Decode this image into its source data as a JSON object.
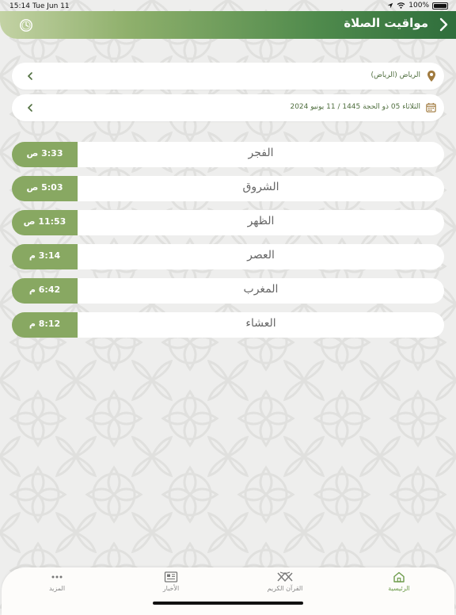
{
  "status_bar": {
    "time": "15:14",
    "date": "Tue Jun 11",
    "battery": "100%"
  },
  "header": {
    "title": "مواقيت الصلاة"
  },
  "location": {
    "text": "الرياض (الرياض)"
  },
  "date_selector": {
    "text": "الثلاثاء 05 ذو الحجة 1445 / 11 يونيو 2024"
  },
  "prayers": [
    {
      "name": "الفجر",
      "time": "3:33 ص"
    },
    {
      "name": "الشروق",
      "time": "5:03 ص"
    },
    {
      "name": "الظهر",
      "time": "11:53 ص"
    },
    {
      "name": "العصر",
      "time": "3:14 م"
    },
    {
      "name": "المغرب",
      "time": "6:42 م"
    },
    {
      "name": "العشاء",
      "time": "8:12 م"
    }
  ],
  "tabs": [
    {
      "label": "الرئيسية",
      "icon": "home-icon",
      "active": true
    },
    {
      "label": "القرآن الكريم",
      "icon": "quran-icon",
      "active": false
    },
    {
      "label": "الأخبار",
      "icon": "news-icon",
      "active": false
    },
    {
      "label": "المزيد",
      "icon": "more-icon",
      "active": false
    }
  ],
  "colors": {
    "accent": "#88a862",
    "header_dark": "#2f6e3c",
    "header_light": "#c3d2a4"
  }
}
